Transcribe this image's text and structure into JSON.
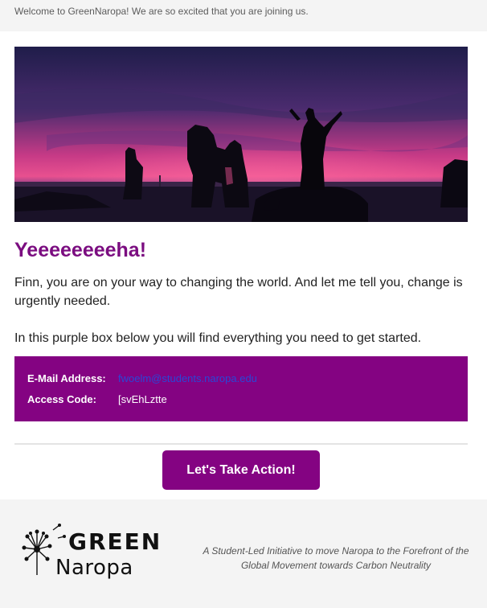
{
  "preheader": "Welcome to GreenNaropa! We are so excited that you are joining us.",
  "hero": {
    "image": "sunset-silhouette-person-on-rocks"
  },
  "headline": "Yeeeeeeeeha!",
  "paragraphs": {
    "p1": "Finn, you are on your way to changing the world. And let me tell you, change is urgently needed.",
    "p2": "In this purple box below you will find everything you need to get started."
  },
  "credentials": {
    "email_label": "E-Mail Address:",
    "email_value": "fwoelm@students.naropa.edu",
    "code_label": "Access Code:",
    "code_value": "[svEhLztte"
  },
  "cta": {
    "label": "Let's Take Action!"
  },
  "footer": {
    "logo_line1": "GREEN",
    "logo_line2": "Naropa",
    "logo_icon": "dandelion-icon",
    "tagline": "A Student-Led Initiative to move Naropa to the Forefront of the Global Movement towards Carbon Neutrality"
  },
  "colors": {
    "brand_purple": "#840382",
    "headline_purple": "#7b0d80",
    "link_blue": "#2a47d6",
    "background": "#f4f4f4"
  }
}
